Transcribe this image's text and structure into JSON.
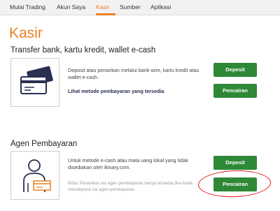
{
  "nav": {
    "items": [
      {
        "label": "Mulai Trading",
        "active": false
      },
      {
        "label": "Akun Saya",
        "active": false
      },
      {
        "label": "Kasir",
        "active": true
      },
      {
        "label": "Sumber",
        "active": false
      },
      {
        "label": "Aplikasi",
        "active": false
      }
    ]
  },
  "page": {
    "title": "Kasir"
  },
  "bank_section": {
    "title": "Transfer bank, kartu kredit, wallet e-cash",
    "icon": "credit-card-icon",
    "description": "Deposit atau penarikan melalui bank-wire, kartu kredit atau wallet e-cash.",
    "link_text": "Lihat metode pembayaran yang tersedia",
    "deposit_label": "Deposit",
    "withdraw_label": "Pencairan"
  },
  "agent_section": {
    "title": "Agen Pembayaran",
    "icon": "payment-agent-icon",
    "description": "Untuk metode e-cash atau mata uang lokal yang tidak disediakan oleh Binary.com.",
    "note": "Nota: Penarikan via agen pembayaran hanya tersedia jika Anda mendeposit via agen pembayaran",
    "deposit_label": "Deposit",
    "withdraw_label": "Pencairan"
  },
  "colors": {
    "accent": "#e98024",
    "button": "#2e8836",
    "icon_dark": "#2a3052",
    "annotation": "#e51b1b"
  }
}
